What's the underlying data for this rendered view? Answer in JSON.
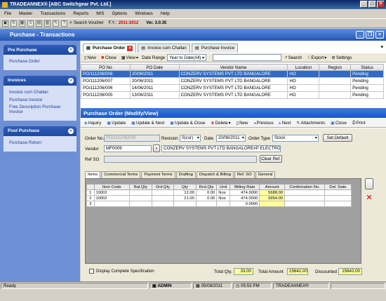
{
  "app": {
    "title": "TRADEANNEX® [ABC Switchgear Pvt. Ltd.]"
  },
  "menu": [
    "File",
    "Master",
    "Transactions",
    "Reports",
    "MIS",
    "Options",
    "Windows",
    "Help"
  ],
  "toolbar": {
    "search_voucher": "Search Voucher",
    "fy_label": "F.Y.:",
    "fy_value": "2011-2012",
    "version": "Ver. 3.0.35"
  },
  "module": {
    "title": "Purchase - Transactions"
  },
  "sidebar": {
    "groups": [
      {
        "title": "Pre Purchase",
        "items": [
          "Purchase Order"
        ]
      },
      {
        "title": "Invoices",
        "items": [
          "Invoice cum Challan",
          "Purchase Invoice",
          "Free Description Purchase Invoice"
        ]
      },
      {
        "title": "Post Purchase",
        "items": [
          "Purchase Return"
        ]
      }
    ]
  },
  "doc_tabs": [
    "Purchase Order",
    "Invoice cum Challan",
    "Purchase Invoice"
  ],
  "grid_toolbar": {
    "new": "New",
    "close": "Close",
    "view": "View",
    "date_range_label": "Date Range",
    "date_range_value": "Year to Date(All)",
    "search": "Search",
    "export": "Export",
    "settings": "Settings"
  },
  "list": {
    "columns": [
      "PO No",
      "PO Date",
      "Vendor Name",
      "Location",
      "Region",
      "Status"
    ],
    "rows": [
      [
        "PO/111206/008",
        "20/06/2011",
        "CONZERV SYSTEMS PVT LTD BANGALORE",
        "HO",
        "",
        "Pending"
      ],
      [
        "PO/111206/007",
        "20/06/2011",
        "CONZERV SYSTEMS PVT LTD BANGALORE",
        "HO",
        "",
        "Pending"
      ],
      [
        "PO/111206/006",
        "14/06/2011",
        "CONZERV SYSTEMS PVT LTD BANGALORE",
        "HO",
        "",
        "Pending"
      ],
      [
        "PO/111206/005",
        "13/06/2011",
        "CONZERV SYSTEMS PVT LTD BANGALORE",
        "HO",
        "",
        "Pending"
      ]
    ]
  },
  "form": {
    "title": "Purchase Order (Modify/View)",
    "toolbar": [
      "Inquiry",
      "Update",
      "Update & Next",
      "Update & Close",
      "Delete",
      "New",
      "Previous",
      "Next",
      "Attachments",
      "Close",
      "Print"
    ],
    "order_no_label": "Order No.",
    "order_no": "PO/111206/008",
    "revision_label": "Revision",
    "revision": "0(cur)",
    "date_label": "Date",
    "date": "20/06/2011",
    "order_type_label": "Order Type",
    "order_type": "Stock",
    "set_default": "Set Default",
    "vendor_label": "Vendor",
    "vendor_code": "MF0009",
    "vendor_name": "CONZERV SYSTEMS PVT LTD BANGALORE#P ELECTRON",
    "ref_so_label": "Ref SO",
    "clear_ref": "Clear Ref.",
    "inner_tabs": [
      "Items",
      "Commercial Terms",
      "Payment Terms",
      "Drafting",
      "Dispatch & Billing",
      "Ref. SO",
      "General"
    ],
    "item_columns": [
      "",
      "Item Code",
      "Bal.Qty",
      "Ord.Qty",
      "Qty",
      "Rcd.Qty",
      "Unit",
      "Billing Rate",
      "Amount",
      "Confirmation No.",
      "Del. Date"
    ],
    "items": [
      [
        "1",
        "10002",
        "",
        "",
        "12.00",
        "0.00",
        "Nos",
        "474.0000",
        "5688.00",
        "",
        ""
      ],
      [
        "2",
        "10002",
        "",
        "",
        "21.00",
        "0.00",
        "Nos",
        "474.0000",
        "9954.00",
        "",
        ""
      ],
      [
        "3",
        "",
        "",
        "",
        "",
        "",
        "",
        "0.0000",
        "",
        "",
        ""
      ]
    ],
    "display_complete_spec": "Display Complete Specification",
    "total_qty_label": "Total Qty.",
    "total_qty": "33.00",
    "total_amount_label": "Total Amount",
    "total_amount": "15642.00",
    "discounted_label": "Discounted",
    "discounted": "15642.00"
  },
  "status": {
    "state": "Ready",
    "user": "ADMIN",
    "date": "05/08/2011",
    "time": "05:53 PM",
    "brand": "TRADEANNEX®"
  }
}
